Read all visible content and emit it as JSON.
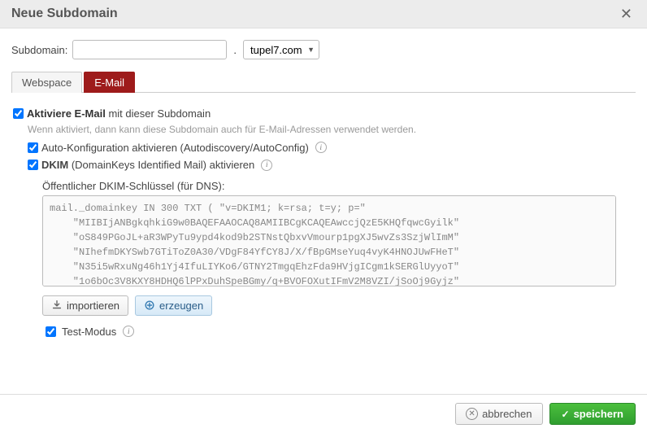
{
  "dialog": {
    "title": "Neue Subdomain"
  },
  "form": {
    "subdomain_label": "Subdomain:",
    "subdomain_value": "",
    "domain_selected": "tupel7.com"
  },
  "tabs": {
    "webspace": "Webspace",
    "email": "E-Mail"
  },
  "email": {
    "activate_bold": "Aktiviere E-Mail",
    "activate_rest": " mit dieser Subdomain",
    "activate_hint": "Wenn aktiviert, dann kann diese Subdomain auch für E-Mail-Adressen verwendet werden.",
    "autoconfig_label": "Auto-Konfiguration aktivieren (Autodiscovery/AutoConfig)",
    "dkim_bold": "DKIM",
    "dkim_rest": " (DomainKeys Identified Mail) aktivieren",
    "dkim_key_label": "Öffentlicher DKIM-Schlüssel (für DNS):",
    "dkim_key_value": "mail._domainkey IN 300 TXT ( \"v=DKIM1; k=rsa; t=y; p=\"\n    \"MIIBIjANBgkqhkiG9w0BAQEFAAOCAQ8AMIIBCgKCAQEAwccjQzE5KHQfqwcGyilk\"\n    \"oS849PGoJL+aR3WPyTu9ypd4kod9b2STNstQbxvVmourp1pgXJ5wvZs3SzjWlImM\"\n    \"NIhefmDKYSwb7GTiToZ0A30/VDgF84YfCY8J/X/fBpGMseYuq4vyK4HNOJUwFHeT\"\n    \"N35i5wRxuNg46h1Yj4IfuLIYKo6/GTNY2TmgqEhzFda9HVjgICgm1kSERGlUyyoT\"\n    \"1o6bOc3V8KXY8HDHQ6lPPxDuhSpeBGmy/q+BVOFOXutIFmV2M8VZI/jSoOj9Gyjz\"",
    "import_btn": "importieren",
    "generate_btn": "erzeugen",
    "test_mode_label": "Test-Modus"
  },
  "footer": {
    "cancel": "abbrechen",
    "save": "speichern"
  }
}
